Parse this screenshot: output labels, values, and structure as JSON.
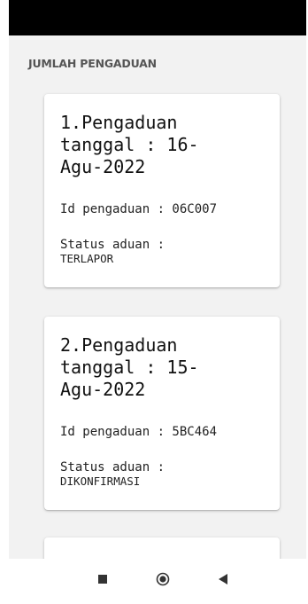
{
  "section_title": "JUMLAH PENGADUAN",
  "complaints": [
    {
      "title": "1.Pengaduan tanggal : 16-Agu-2022",
      "id_text": "Id pengaduan : 06C007",
      "status_label": "Status aduan :",
      "status_value": "TERLAPOR"
    },
    {
      "title": "2.Pengaduan tanggal : 15-Agu-2022",
      "id_text": "Id pengaduan : 5BC464",
      "status_label": "Status aduan :",
      "status_value": "DIKONFIRMASI"
    }
  ],
  "nav_bar": {
    "recent_icon": "square-icon",
    "home_icon": "circle-icon",
    "back_icon": "triangle-back-icon"
  },
  "colors": {
    "status_bar": "#000000",
    "background": "#f2f2f2",
    "card": "#ffffff",
    "section_title": "#555555"
  }
}
